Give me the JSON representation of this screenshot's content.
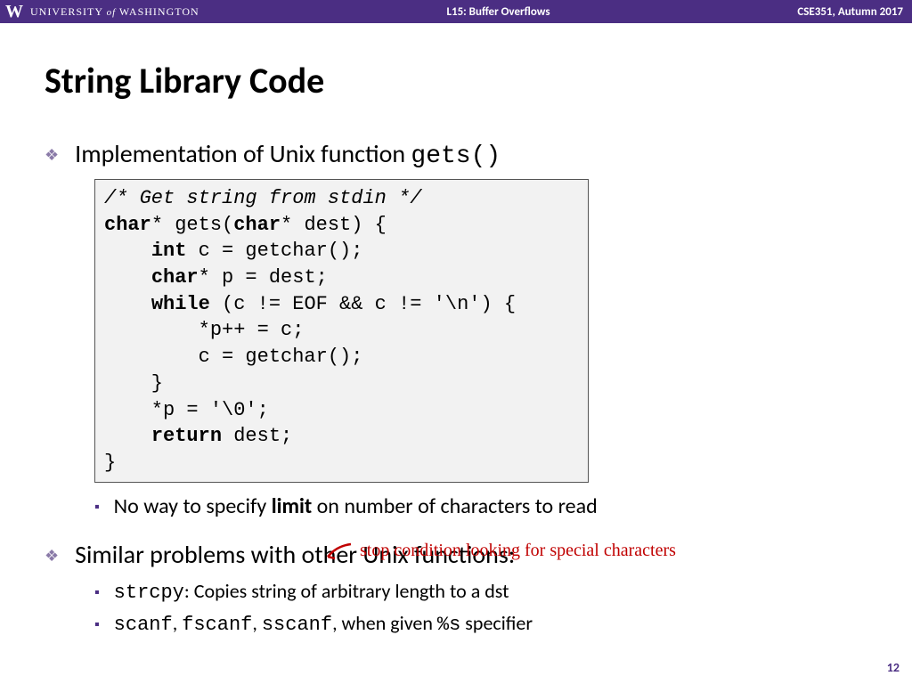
{
  "header": {
    "logo": "W",
    "university_pre": "UNIVERSITY ",
    "university_of": "of",
    "university_post": " WASHINGTON",
    "center": "L15:  Buffer Overflows",
    "right": "CSE351, Autumn 2017"
  },
  "title": "String Library Code",
  "b1_pre": "Implementation of Unix function ",
  "b1_code": "gets()",
  "code": {
    "l1": "/* Get string from stdin */",
    "l2a": "char",
    "l2b": "* gets(",
    "l2c": "char",
    "l2d": "* dest) {",
    "l3a": "    ",
    "l3b": "int",
    "l3c": " c = getchar();",
    "l4a": "    ",
    "l4b": "char",
    "l4c": "* p = dest;",
    "l5a": "    ",
    "l5b": "while",
    "l5c": " (c != EOF && c != '\\n') {",
    "l6": "        *p++ = c;",
    "l7": "        c = getchar();",
    "l8": "    }",
    "l9": "    *p = '\\0';",
    "l10a": "    ",
    "l10b": "return",
    "l10c": " dest;",
    "l11": "}"
  },
  "sub1_pre": "No way to specify ",
  "sub1_bold": "limit",
  "sub1_post": " on number of characters to read",
  "annotation": "stop condition  looking for special  characters",
  "b2": "Similar problems with other Unix functions:",
  "sub2a_code": "strcpy",
  "sub2a_text": ":  Copies string of arbitrary length to a dst",
  "sub2b_c1": "scanf",
  "sub2b_s1": ", ",
  "sub2b_c2": "fscanf",
  "sub2b_s2": ", ",
  "sub2b_c3": "sscanf",
  "sub2b_s3": ", when given ",
  "sub2b_c4": "%s",
  "sub2b_s4": " specifier",
  "page": "12"
}
